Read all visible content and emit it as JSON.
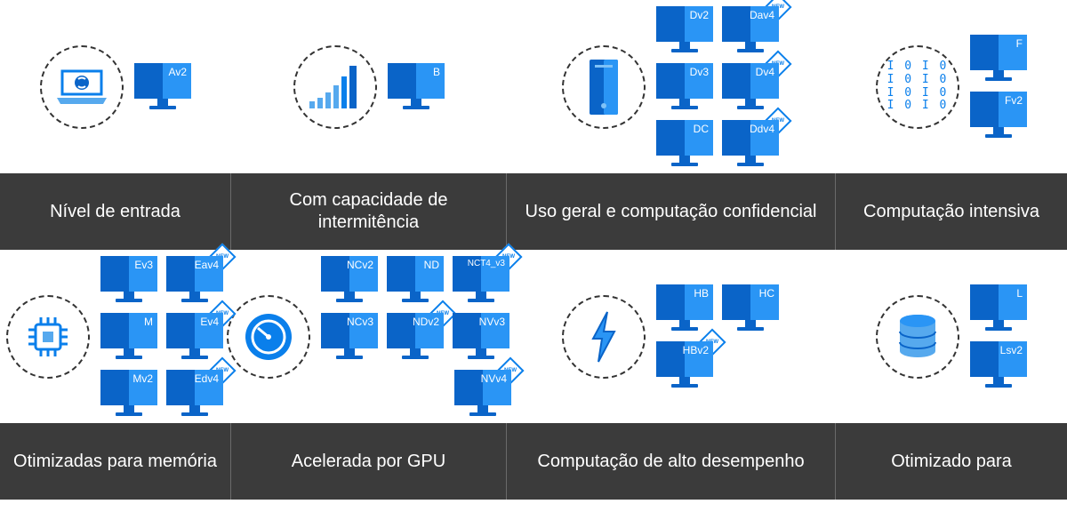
{
  "labels": {
    "r1c1": "Nível de entrada",
    "r1c2": "Com capacidade de intermitência",
    "r1c3": "Uso geral e computação confidencial",
    "r1c4": "Computação intensiva",
    "r2c1": "Otimizadas para memória",
    "r2c2": "Acelerada por GPU",
    "r2c3": "Computação de alto desempenho",
    "r2c4": "Otimizado para"
  },
  "badge": "NEW",
  "vm": {
    "av2": "Av2",
    "b": "B",
    "dv2": "Dv2",
    "dav4": "Dav4",
    "dv3": "Dv3",
    "dv4": "Dv4",
    "dc": "DC",
    "ddv4": "Ddv4",
    "f": "F",
    "fv2": "Fv2",
    "ev3": "Ev3",
    "eav4": "Eav4",
    "m": "M",
    "ev4": "Ev4",
    "mv2": "Mv2",
    "edv4": "Edv4",
    "ncv2": "NCv2",
    "nd": "ND",
    "nct4v3": "NCT4_v3",
    "ncv3": "NCv3",
    "ndv2": "NDv2",
    "nvv3": "NVv3",
    "nvv4": "NVv4",
    "hb": "HB",
    "hc": "HC",
    "hbv2": "HBv2",
    "l": "L",
    "lsv2": "Lsv2"
  },
  "binary": "I 0 I 0"
}
